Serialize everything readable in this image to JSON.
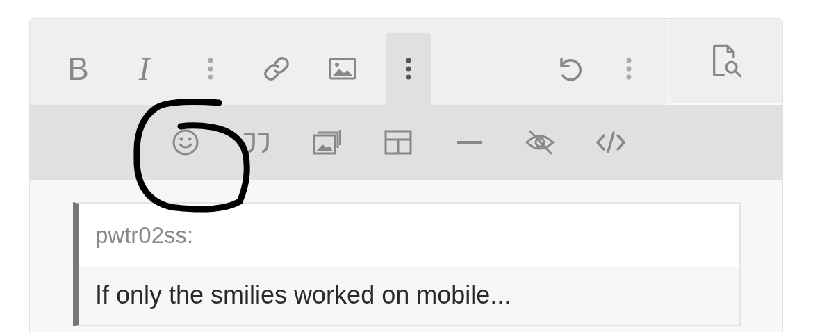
{
  "toolbar": {
    "buttons": [
      {
        "kind": "bold",
        "label": "B",
        "selected": false
      },
      {
        "kind": "italic",
        "label": "I",
        "selected": false
      },
      {
        "kind": "dots",
        "selected": false
      },
      {
        "kind": "link",
        "selected": false
      },
      {
        "kind": "image",
        "selected": false
      },
      {
        "kind": "dots",
        "selected": true
      }
    ],
    "end_buttons": [
      {
        "kind": "undo",
        "selected": false
      },
      {
        "kind": "dots",
        "selected": false
      }
    ],
    "preview": {
      "kind": "preview"
    }
  },
  "subtoolbar": {
    "buttons": [
      {
        "kind": "smiley"
      },
      {
        "kind": "quote"
      },
      {
        "kind": "gallery"
      },
      {
        "kind": "table"
      },
      {
        "kind": "rule"
      },
      {
        "kind": "hide"
      },
      {
        "kind": "code"
      }
    ]
  },
  "quote": {
    "author": "pwtr02ss:",
    "text": "If only the smilies worked on mobile..."
  }
}
